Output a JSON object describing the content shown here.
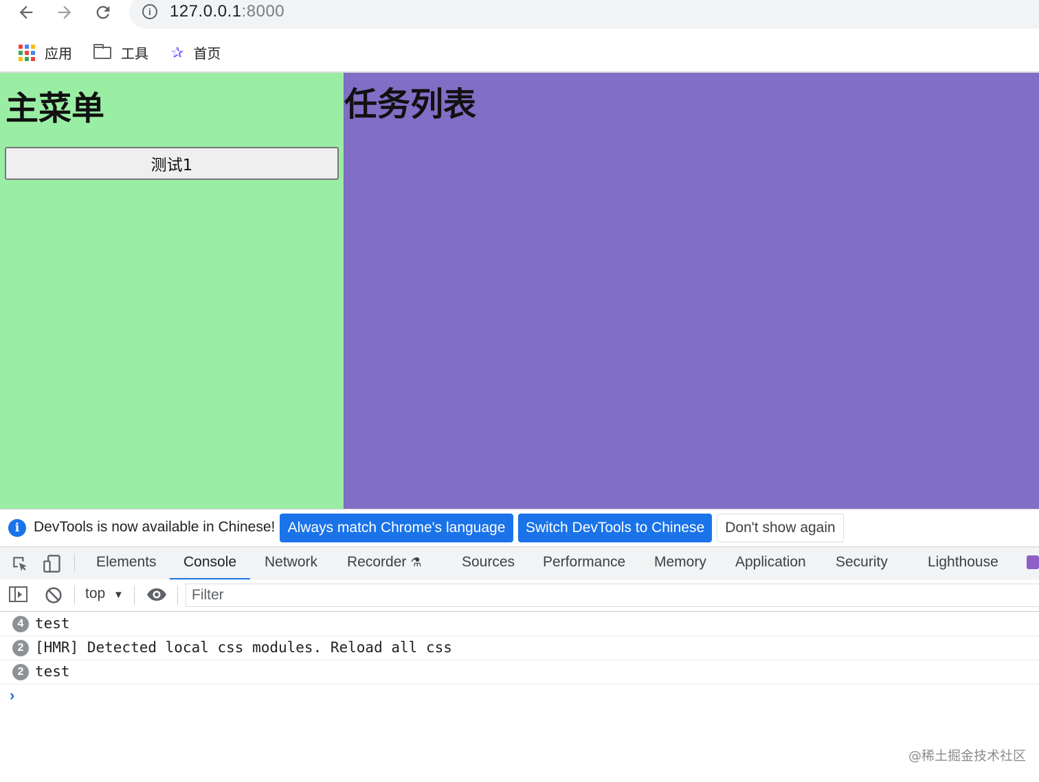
{
  "browser": {
    "url_host": "127.0.0.1",
    "url_port": ":8000",
    "bookmarks": [
      {
        "label": "应用",
        "icon": "apps-grid-icon"
      },
      {
        "label": "工具",
        "icon": "folder-icon"
      },
      {
        "label": "首页",
        "icon": "star-bookmark-icon"
      }
    ]
  },
  "page": {
    "left_title": "主菜单",
    "right_title": "任务列表",
    "button_label": "测试1",
    "colors": {
      "left_bg": "#9aeea4",
      "right_bg": "#816ec6"
    }
  },
  "devtools": {
    "banner": {
      "text": "DevTools is now available in Chinese!",
      "btn_match": "Always match Chrome's language",
      "btn_switch": "Switch DevTools to Chinese",
      "btn_dismiss": "Don't show again"
    },
    "tabs": [
      "Elements",
      "Console",
      "Network",
      "Recorder",
      "Sources",
      "Performance",
      "Memory",
      "Application",
      "Security",
      "Lighthouse"
    ],
    "active_tab": "Console",
    "context": "top",
    "filter_placeholder": "Filter",
    "messages": [
      {
        "count": "4",
        "text": "test"
      },
      {
        "count": "2",
        "text": "[HMR] Detected local css modules. Reload all css"
      },
      {
        "count": "2",
        "text": "test"
      }
    ],
    "prompt": "›",
    "accent": "#1a73e8"
  },
  "watermark": "@稀土掘金技术社区"
}
